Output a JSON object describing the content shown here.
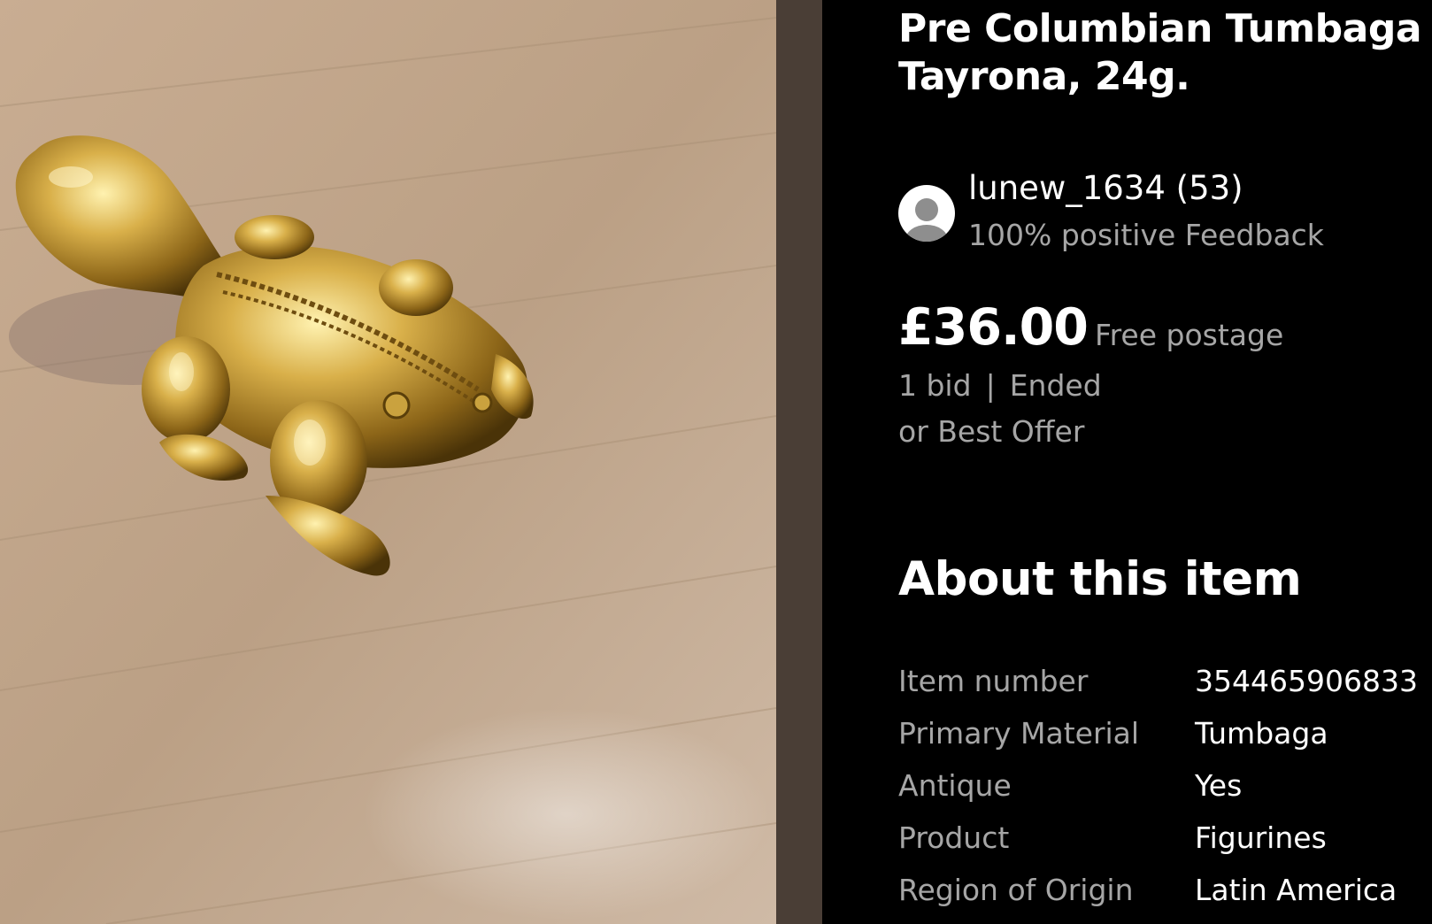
{
  "photo": {
    "description_icon": "gold-frog-figurine-image"
  },
  "listing": {
    "title": "Pre Columbian Tumbaga Tayrona, 24g."
  },
  "seller": {
    "name": "lunew_1634 (53)",
    "feedback": "100% positive Feedback",
    "avatar_icon": "user-avatar-icon"
  },
  "pricing": {
    "price": "£36.00",
    "postage": "Free postage",
    "bids": "1 bid",
    "separator": "|",
    "status": "Ended",
    "best_offer": "or Best Offer"
  },
  "about": {
    "heading": "About this item",
    "specs": [
      {
        "label": "Item number",
        "value": "354465906833"
      },
      {
        "label": "Primary Material",
        "value": "Tumbaga"
      },
      {
        "label": "Antique",
        "value": "Yes"
      },
      {
        "label": "Product",
        "value": "Figurines"
      },
      {
        "label": "Region of Origin",
        "value": "Latin America"
      }
    ]
  },
  "colors": {
    "panel_background": "#000000",
    "secondary_text": "#a6a6a6",
    "primary_text": "#ffffff",
    "divider": "#4a3e36"
  }
}
